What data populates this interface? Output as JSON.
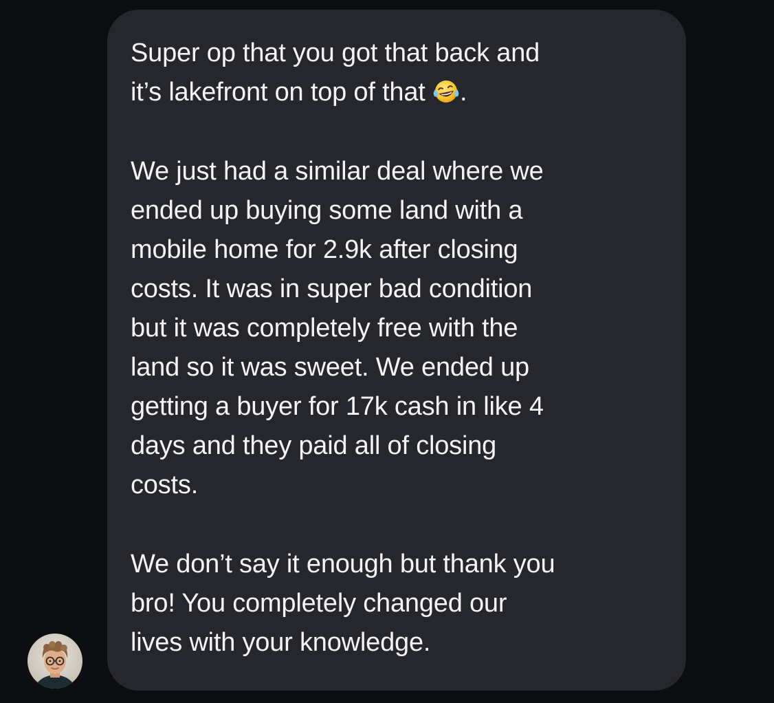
{
  "conversation": {
    "message": {
      "paragraphs": [
        {
          "lines": [
            "Super op that you got that back and",
            "it’s lakefront on top of that"
          ],
          "trailing_emoji": "tears-of-joy-emoji",
          "trailing_text": "."
        },
        {
          "lines": [
            "We just had a similar deal where we",
            "ended up buying some land with a",
            "mobile home for 2.9k after closing",
            "costs. It was in super bad condition",
            "but it was completely free with the",
            "land so it was sweet. We ended up",
            "getting a buyer for 17k cash in like 4",
            "days and they paid all of closing",
            "costs."
          ]
        },
        {
          "lines": [
            "We don’t say it enough but thank you",
            "bro! You completely changed our",
            "lives with your knowledge."
          ]
        }
      ]
    },
    "sender_avatar": "profile-photo"
  },
  "colors": {
    "background": "#0c0d10",
    "bubble": "#26272c",
    "text": "#f4f4f6"
  }
}
